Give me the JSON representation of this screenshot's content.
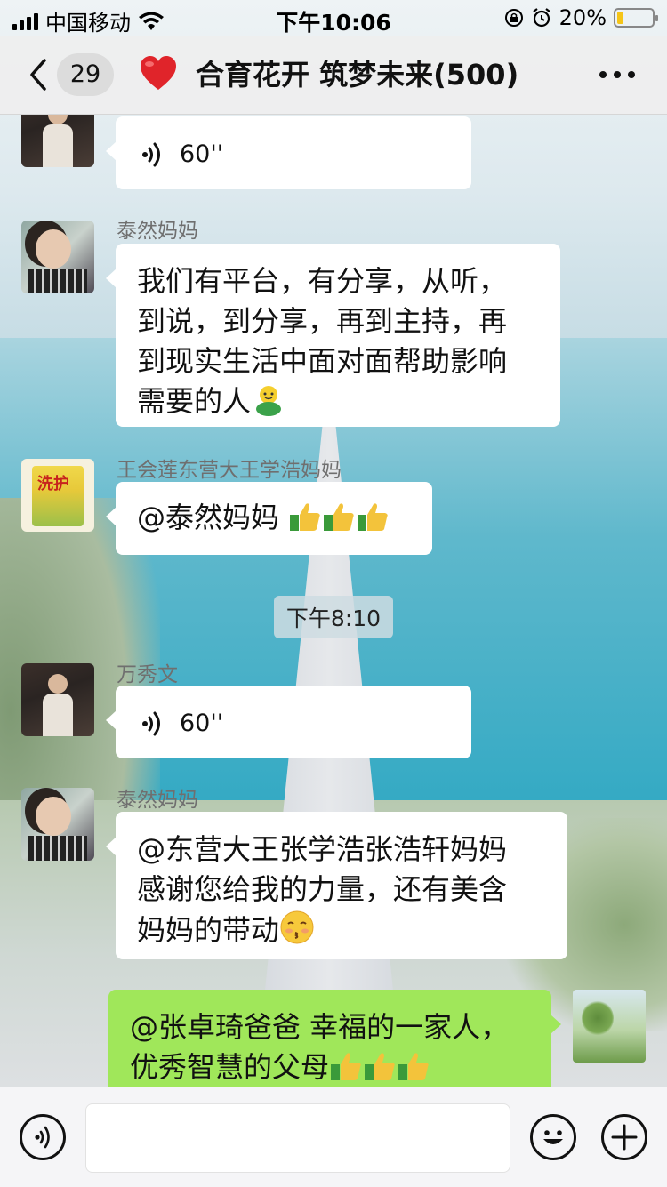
{
  "status_bar": {
    "carrier": "中国移动",
    "time": "下午10:06",
    "battery_percent": "20%",
    "battery_level": 0.2
  },
  "nav": {
    "unread_count": "29",
    "title": "合育花开 筑梦未来(500)"
  },
  "messages": [
    {
      "type": "voice",
      "sender": "",
      "duration": "60''"
    },
    {
      "type": "text",
      "sender": "泰然妈妈",
      "lines": [
        "我们有平台，有分享，从听，",
        "到说，到分享，再到主持，再",
        "到现实生活中面对面帮助影响",
        "需要的人"
      ],
      "emoji": "green-smiley-hug"
    },
    {
      "type": "text",
      "sender": "王会莲东营大王学浩妈妈",
      "text": "@泰然妈妈 ",
      "emoji": "thumbs-up x3"
    },
    {
      "type": "timestamp",
      "text": "下午8:10"
    },
    {
      "type": "voice",
      "sender": "万秀文",
      "duration": "60''"
    },
    {
      "type": "text",
      "sender": "泰然妈妈",
      "lines": [
        "@东营大王张学浩张浩轩妈妈",
        "感谢您给我的力量，还有美含",
        "妈妈的带动"
      ],
      "emoji": "kissing-face"
    },
    {
      "type": "text",
      "sender": "self",
      "lines": [
        "@张卓琦爸爸 幸福的一家人，",
        "优秀智慧的父母"
      ],
      "emoji": "thumbs-up x3"
    }
  ],
  "colors": {
    "self_bubble": "#a0e75a",
    "other_bubble": "#ffffff",
    "nav_bg": "#eeeeee"
  },
  "icons": [
    "back-icon",
    "heart-icon",
    "more-icon",
    "voice-icon",
    "voice-input-icon",
    "emoji-icon",
    "add-icon"
  ]
}
